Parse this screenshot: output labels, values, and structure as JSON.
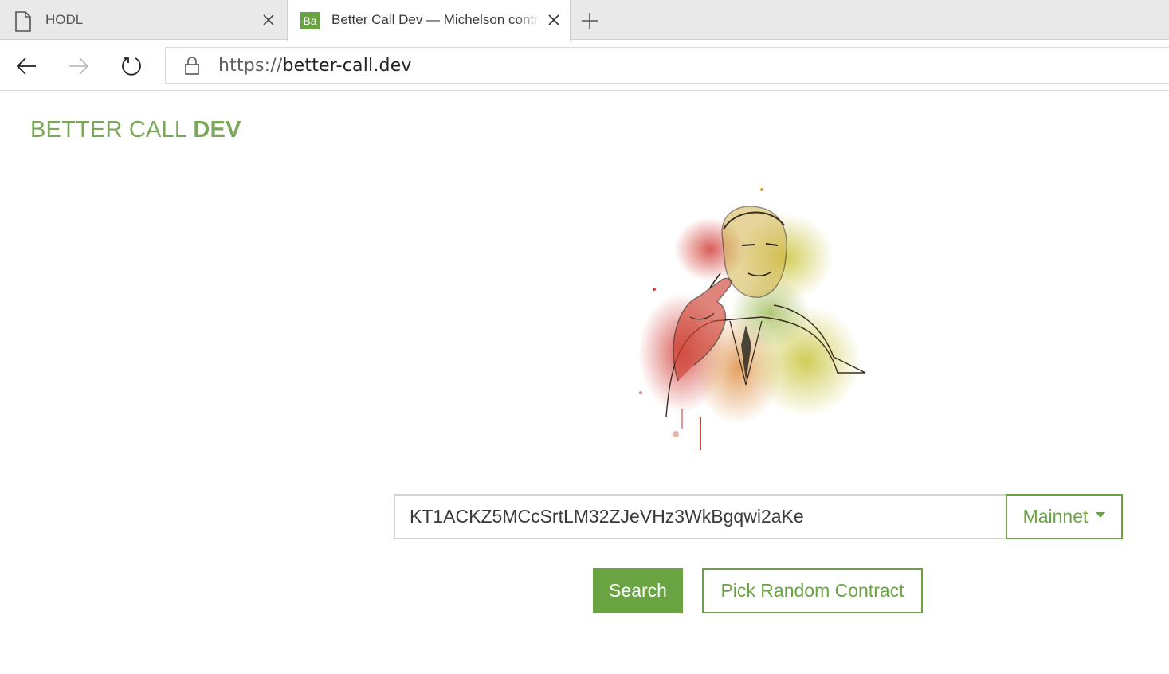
{
  "browser": {
    "tabs": [
      {
        "title": "HODL",
        "icon": "page-icon",
        "active": false
      },
      {
        "title": "Better Call Dev — Michelson contract explorer",
        "favicon_text": "Ba",
        "icon": "site-favicon",
        "active": true
      }
    ],
    "url": {
      "scheme": "https://",
      "host": "better-call.dev"
    },
    "nav_icons": [
      "back-arrow-icon",
      "forward-arrow-icon",
      "refresh-icon",
      "lock-icon",
      "plus-icon",
      "close-icon"
    ]
  },
  "header": {
    "brand_light": "BETTER CALL ",
    "brand_bold": "DEV"
  },
  "hero": {
    "icon": "hero-illustration"
  },
  "search": {
    "value": "KT1ACKZ5MCcSrtLM32ZJeVHz3WkBgqwi2aKe",
    "network_label": "Mainnet"
  },
  "actions": {
    "search_label": "Search",
    "random_label": "Pick Random Contract"
  },
  "colors": {
    "accent": "#6aa342",
    "brand_text": "#79a85a",
    "tabstrip": "#e9e9e9"
  }
}
